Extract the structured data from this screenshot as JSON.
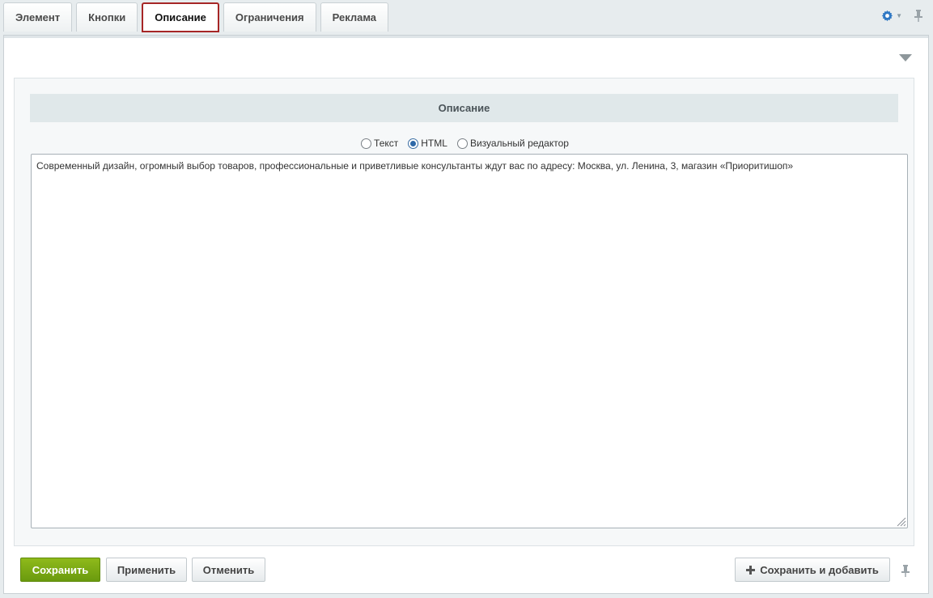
{
  "tabs": [
    {
      "label": "Элемент",
      "active": false
    },
    {
      "label": "Кнопки",
      "active": false
    },
    {
      "label": "Описание",
      "active": true
    },
    {
      "label": "Ограничения",
      "active": false
    },
    {
      "label": "Реклама",
      "active": false
    }
  ],
  "section": {
    "title": "Описание"
  },
  "editor_mode": {
    "options": [
      "Текст",
      "HTML",
      "Визуальный редактор"
    ],
    "selected": "HTML"
  },
  "editor": {
    "value": "Современный дизайн, огромный выбор товаров, профессиональные и приветливые консультанты ждут вас по адресу:  Москва, ул. Ленина, 3, магазин «Приоритишоп»"
  },
  "footer": {
    "save_label": "Сохранить",
    "apply_label": "Применить",
    "cancel_label": "Отменить",
    "save_add_label": "Сохранить и добавить"
  },
  "icons": {
    "settings": "gear-icon",
    "pin": "pin-icon",
    "collapse": "triangle-down-icon",
    "add": "plus-icon"
  },
  "colors": {
    "active_tab_border": "#a62626",
    "save_button": "#7aa814",
    "accent_blue": "#2e69a8"
  }
}
